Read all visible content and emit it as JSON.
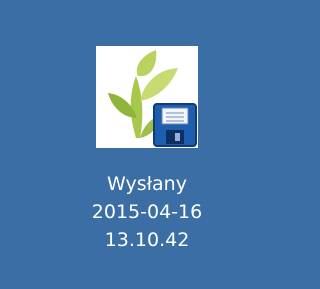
{
  "desktop": {
    "background_color": "#3a6ea5",
    "shortcut": {
      "icon": "plant-leaf-with-floppy-disk-icon",
      "label_lines": [
        "Wysłany",
        "2015-04-16",
        "13.10.42"
      ]
    }
  }
}
